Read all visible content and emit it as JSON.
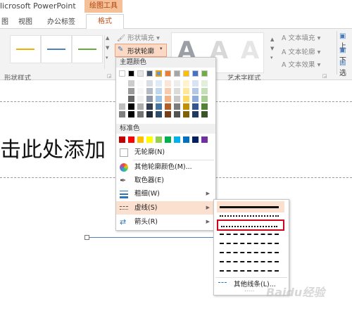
{
  "app": {
    "title": "licrosoft PowerPoint",
    "contextual_tab_group": "绘图工具"
  },
  "tabs": [
    {
      "label": "图"
    },
    {
      "label": "视图"
    },
    {
      "label": "办公标签"
    },
    {
      "label": "格式"
    }
  ],
  "ribbon": {
    "shape_styles_label": "形状样式",
    "shape_fill": "形状填充",
    "shape_outline": "形状轮廓",
    "shape_effects": "",
    "wordart_styles_label": "艺术字样式",
    "text_fill": "文本填充",
    "text_outline": "文本轮廓",
    "text_effects": "文本效果",
    "arrange_items": [
      "上",
      "下",
      "选"
    ],
    "style_line_colors": [
      "#f0b000",
      "#4f81bd",
      "#6aab3e"
    ]
  },
  "slide": {
    "placeholder_text": "击此处添加"
  },
  "outline_menu": {
    "theme_colors_header": "主题颜色",
    "standard_colors_header": "标准色",
    "theme_colors_top": [
      "#ffffff",
      "#000000",
      "#e7e6e6",
      "#44546a",
      "#5b9bd5",
      "#ed7d31",
      "#a5a5a5",
      "#ffc000",
      "#4472c4",
      "#70ad47"
    ],
    "standard_colors": [
      "#c00000",
      "#ff0000",
      "#ffc000",
      "#ffff00",
      "#92d050",
      "#00b050",
      "#00b0f0",
      "#0070c0",
      "#002060",
      "#7030a0"
    ],
    "items": [
      {
        "label": "无轮廓(N)",
        "icon": "no-outline-icon"
      },
      {
        "label": "其他轮廓颜色(M)...",
        "icon": "palette-icon"
      },
      {
        "label": "取色器(E)",
        "icon": "eyedropper-icon"
      },
      {
        "label": "粗细(W)",
        "icon": "line-weight-icon"
      },
      {
        "label": "虚线(S)",
        "icon": "dash-icon"
      },
      {
        "label": "箭头(R)",
        "icon": "arrow-icon"
      }
    ]
  },
  "dash_submenu": {
    "styles": [
      "solid",
      "round-dot",
      "square-dot",
      "dash",
      "dash-dot",
      "long-dash",
      "long-dash-dot",
      "long-dash-dot-dot"
    ],
    "selected_style": "square-dot",
    "more_lines": "其他线条(L)...",
    "more_dots": "....."
  },
  "watermark": "Baidu经验"
}
